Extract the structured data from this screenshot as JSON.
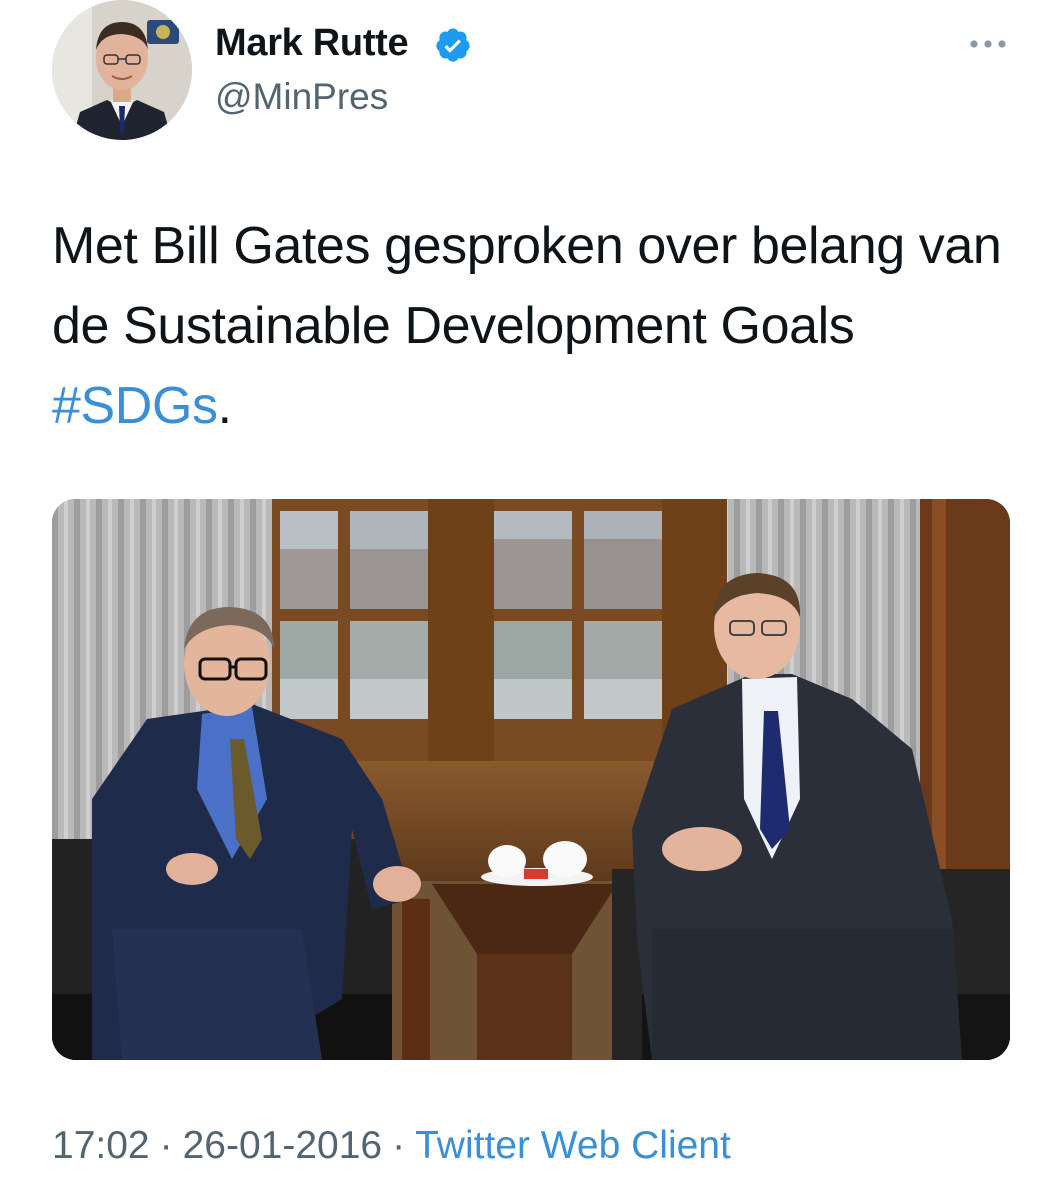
{
  "author": {
    "name": "Mark Rutte",
    "handle": "@MinPres",
    "verified": true,
    "avatar_icon": "profile-photo",
    "verified_icon": "verified-badge-icon"
  },
  "more_icon": "more-options-icon",
  "tweet": {
    "text_before": "Met Bill Gates gesproken over belang van de Sustainable Development Goals ",
    "hashtag": "#SDGs",
    "text_after": "."
  },
  "meta": {
    "time": "17:02",
    "separator": "·",
    "date": "26-01-2016",
    "source": "Twitter Web Client"
  },
  "colors": {
    "text": "#0f1419",
    "secondary": "#536471",
    "link": "#3a8fd6",
    "verified": "#1d9bf0"
  }
}
